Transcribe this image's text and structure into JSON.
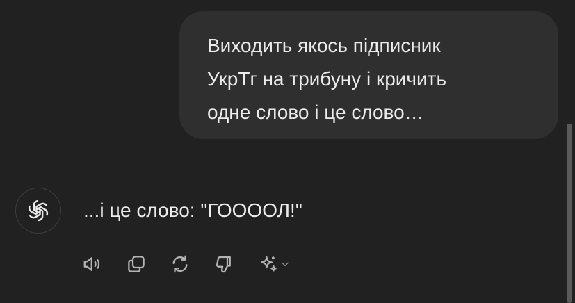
{
  "conversation": {
    "user_message": "Виходить якось підписник\nУкрТг на трибуну і кричить\nодне слово і це слово…",
    "assistant_message": "...і це слово: \"ГООООЛ!\""
  },
  "assistant_avatar": {
    "icon": "openai-logo-icon"
  },
  "message_actions": [
    {
      "icon": "speaker-icon"
    },
    {
      "icon": "copy-icon"
    },
    {
      "icon": "regenerate-icon"
    },
    {
      "icon": "thumbs-down-icon"
    },
    {
      "icon": "sparkle-icon"
    }
  ],
  "colors": {
    "background": "#212121",
    "user_bubble": "#2f2f2f",
    "text": "#ececec",
    "icon": "#b4b4b4"
  }
}
